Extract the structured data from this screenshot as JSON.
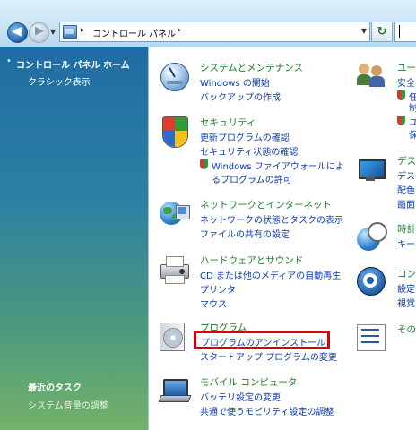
{
  "address_bar": {
    "path_label": "コントロール パネル",
    "sep": "▸",
    "dropdown_glyph": "▼",
    "back_glyph": "◀",
    "forward_glyph": "▶",
    "refresh_glyph": "↻"
  },
  "sidebar": {
    "home_bullet": "•",
    "home_label": "コントロール パネル ホーム",
    "classic_label": "クラシック表示",
    "recent_title": "最近のタスク",
    "recent_items": [
      "システム音量の調整"
    ]
  },
  "categories": [
    {
      "title": "システムとメンテナンス",
      "links": [
        "Windows の開始",
        "バックアップの作成"
      ]
    },
    {
      "title": "セキュリティ",
      "links": [
        "更新プログラムの確認",
        "セキュリティ状態の確認",
        "Windows ファイアウォールによ",
        "るプログラムの許可"
      ]
    },
    {
      "title": "ネットワークとインターネット",
      "links": [
        "ネットワークの状態とタスクの表示",
        "ファイルの共有の設定"
      ]
    },
    {
      "title": "ハードウェアとサウンド",
      "links": [
        "CD または他のメディアの自動再生",
        "プリンタ",
        "マウス"
      ]
    },
    {
      "title": "プログラム",
      "links": [
        "プログラムのアンインストール",
        "スタートアップ プログラムの変更"
      ]
    },
    {
      "title": "モバイル コンピュータ",
      "links": [
        "バッテリ設定の変更",
        "共通で使うモビリティ設定の調整"
      ]
    }
  ],
  "right_categories": [
    {
      "title": "ユー",
      "links": [
        "安全",
        "任",
        "制",
        "ユ",
        "保"
      ]
    },
    {
      "title": "デス",
      "links": [
        "デス",
        "配色",
        "画面"
      ]
    },
    {
      "title": "時計",
      "links": [
        "キー"
      ]
    },
    {
      "title": "コン",
      "links": [
        "設定",
        "視覚"
      ]
    },
    {
      "title": "その"
    }
  ],
  "colors": {
    "highlight": "#e00000",
    "title_green": "#1a7d2c",
    "link_blue": "#0b3aa9"
  }
}
